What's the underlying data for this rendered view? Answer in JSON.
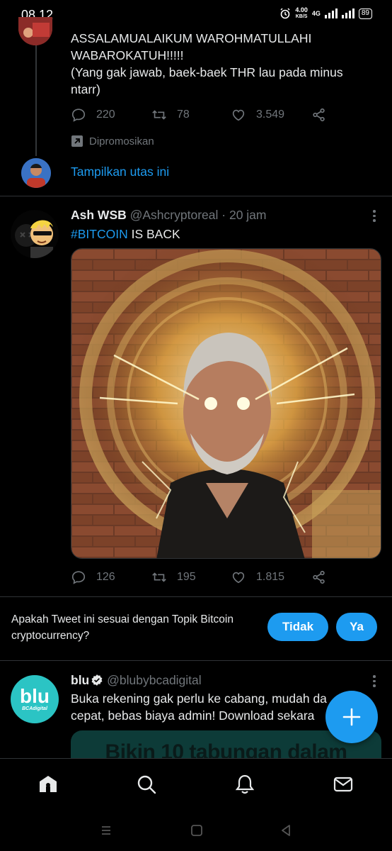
{
  "status_bar": {
    "time": "08.12",
    "net_speed_value": "4.00",
    "net_speed_unit": "KB/S",
    "network_type": "4G",
    "battery": "89"
  },
  "tweet1": {
    "line1": "ASSALAMUALAIKUM WAROHMATULLAHI",
    "line2": "WABAROKATUH!!!!!",
    "line3": "(Yang gak jawab, baek-baek THR lau pada minus",
    "line4": "ntarr)",
    "replies": "220",
    "retweets": "78",
    "likes": "3.549",
    "promoted_label": "Dipromosikan",
    "show_thread": "Tampilkan utas ini"
  },
  "tweet2": {
    "name": "Ash WSB",
    "handle": "@Ashcryptoreal",
    "separator": "·",
    "time": "20 jam",
    "hashtag": "#BITCOIN",
    "text_rest": " IS BACK",
    "replies": "126",
    "retweets": "195",
    "likes": "1.815"
  },
  "topic_prompt": {
    "question": "Apakah Tweet ini sesuai dengan Topik Bitcoin cryptocurrency?",
    "no_label": "Tidak",
    "yes_label": "Ya"
  },
  "tweet3": {
    "name": "blu",
    "handle": "@blubybcadigital",
    "line1": "Buka rekening gak perlu ke cabang, mudah da",
    "line2": "cepat, bebas biaya admin! Download sekara",
    "avatar_text": "blu",
    "avatar_subtext": "BCAdigital",
    "card_text": "Bikin 10 tabungan dalam"
  },
  "colors": {
    "accent": "#1d9bf0",
    "background": "#000000",
    "muted": "#71767b",
    "blu_brand": "#2bc4c4"
  },
  "icons": {
    "reply": "reply-icon",
    "retweet": "retweet-icon",
    "like": "like-icon",
    "share": "share-icon",
    "home": "home-icon",
    "search": "search-icon",
    "notifications": "bell-icon",
    "messages": "mail-icon",
    "compose": "plus-icon"
  }
}
